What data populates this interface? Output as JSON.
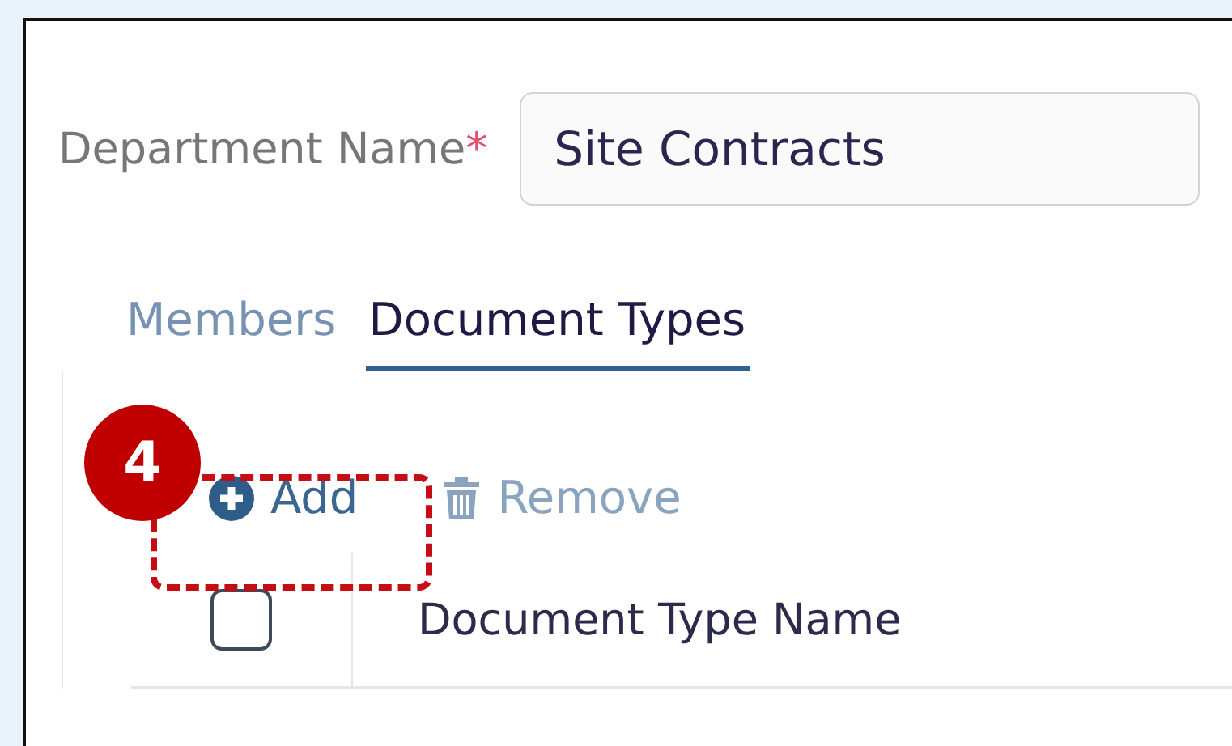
{
  "form": {
    "label": "Department Name",
    "required_mark": "*",
    "value": "Site Contracts"
  },
  "tabs": [
    {
      "label": "Members",
      "selected": false
    },
    {
      "label": "Document Types",
      "selected": true
    }
  ],
  "toolbar": [
    {
      "kind": "add",
      "label": "Add"
    },
    {
      "kind": "remove",
      "label": "Remove"
    }
  ],
  "table": {
    "select_all": {
      "checked": false
    },
    "columns": [
      "Document Type Name"
    ]
  },
  "annotation": {
    "number": "4"
  }
}
